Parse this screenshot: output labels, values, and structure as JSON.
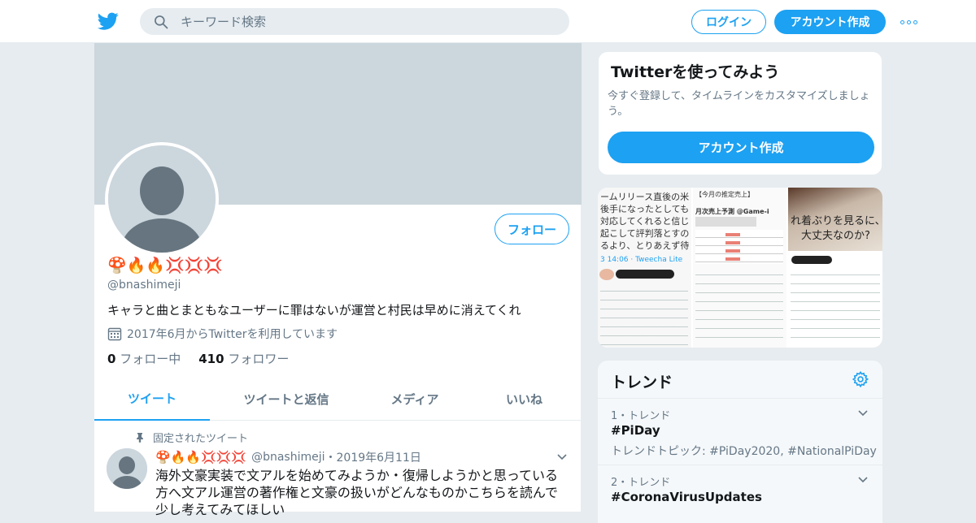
{
  "header": {
    "search_placeholder": "キーワード検索",
    "login_label": "ログイン",
    "signup_label": "アカウント作成"
  },
  "profile": {
    "display_name": "🍄🔥🔥💢💢💢",
    "handle": "@bnashimeji",
    "bio": "キャラと曲とまともなユーザーに罪はないが運営と村民は早めに消えてくれ",
    "joined": "2017年6月からTwitterを利用しています",
    "following_count": "0",
    "following_label": "フォロー中",
    "followers_count": "410",
    "followers_label": "フォロワー",
    "follow_button": "フォロー"
  },
  "tabs": [
    {
      "label": "ツイート",
      "active": true
    },
    {
      "label": "ツイートと返信",
      "active": false
    },
    {
      "label": "メディア",
      "active": false
    },
    {
      "label": "いいね",
      "active": false
    }
  ],
  "tweet": {
    "pinned_label": "固定されたツイート",
    "name": "🍄🔥🔥💢💢💢",
    "handle": "@bnashimeji",
    "separator": "・",
    "date": "2019年6月11日",
    "text": "海外文豪実装で文アルを始めてみようか・復帰しようかと思っている方へ文アル運営の著作権と文豪の扱いがどんなものかこちらを読んで少し考えてみてほしい"
  },
  "sidebar": {
    "signup_card": {
      "title": "Twitterを使ってみよう",
      "text": "今すぐ登録して、タイムラインをカスタマイズしましょう。",
      "button": "アカウント作成"
    },
    "media": {
      "thumb1_lines": [
        "ームリリース直後の米",
        "後手になったとしても",
        "対応してくれると信じ",
        "起こして評判落とすの",
        "るより、とりあえず待"
      ],
      "thumb1_time": "3 14:06 · Tweecha Lite",
      "thumb2_header": "【今月の推定売上】",
      "thumb2_sub": "月次売上予測 @Game-i",
      "thumb3_lines": [
        "れ着ぶりを見るに、ヤ",
        "大丈夫なのか?"
      ]
    },
    "trends": {
      "title": "トレンド",
      "items": [
        {
          "meta": "1・トレンド",
          "tag": "#PiDay",
          "sub": "トレンドトピック: #PiDay2020, #NationalPiDay"
        },
        {
          "meta": "2・トレンド",
          "tag": "#CoronaVirusUpdates",
          "sub": ""
        }
      ]
    }
  },
  "colors": {
    "accent": "#1da1f2",
    "background": "#e6ecf0",
    "muted_text": "#657786",
    "banner": "#ccd6dd"
  }
}
